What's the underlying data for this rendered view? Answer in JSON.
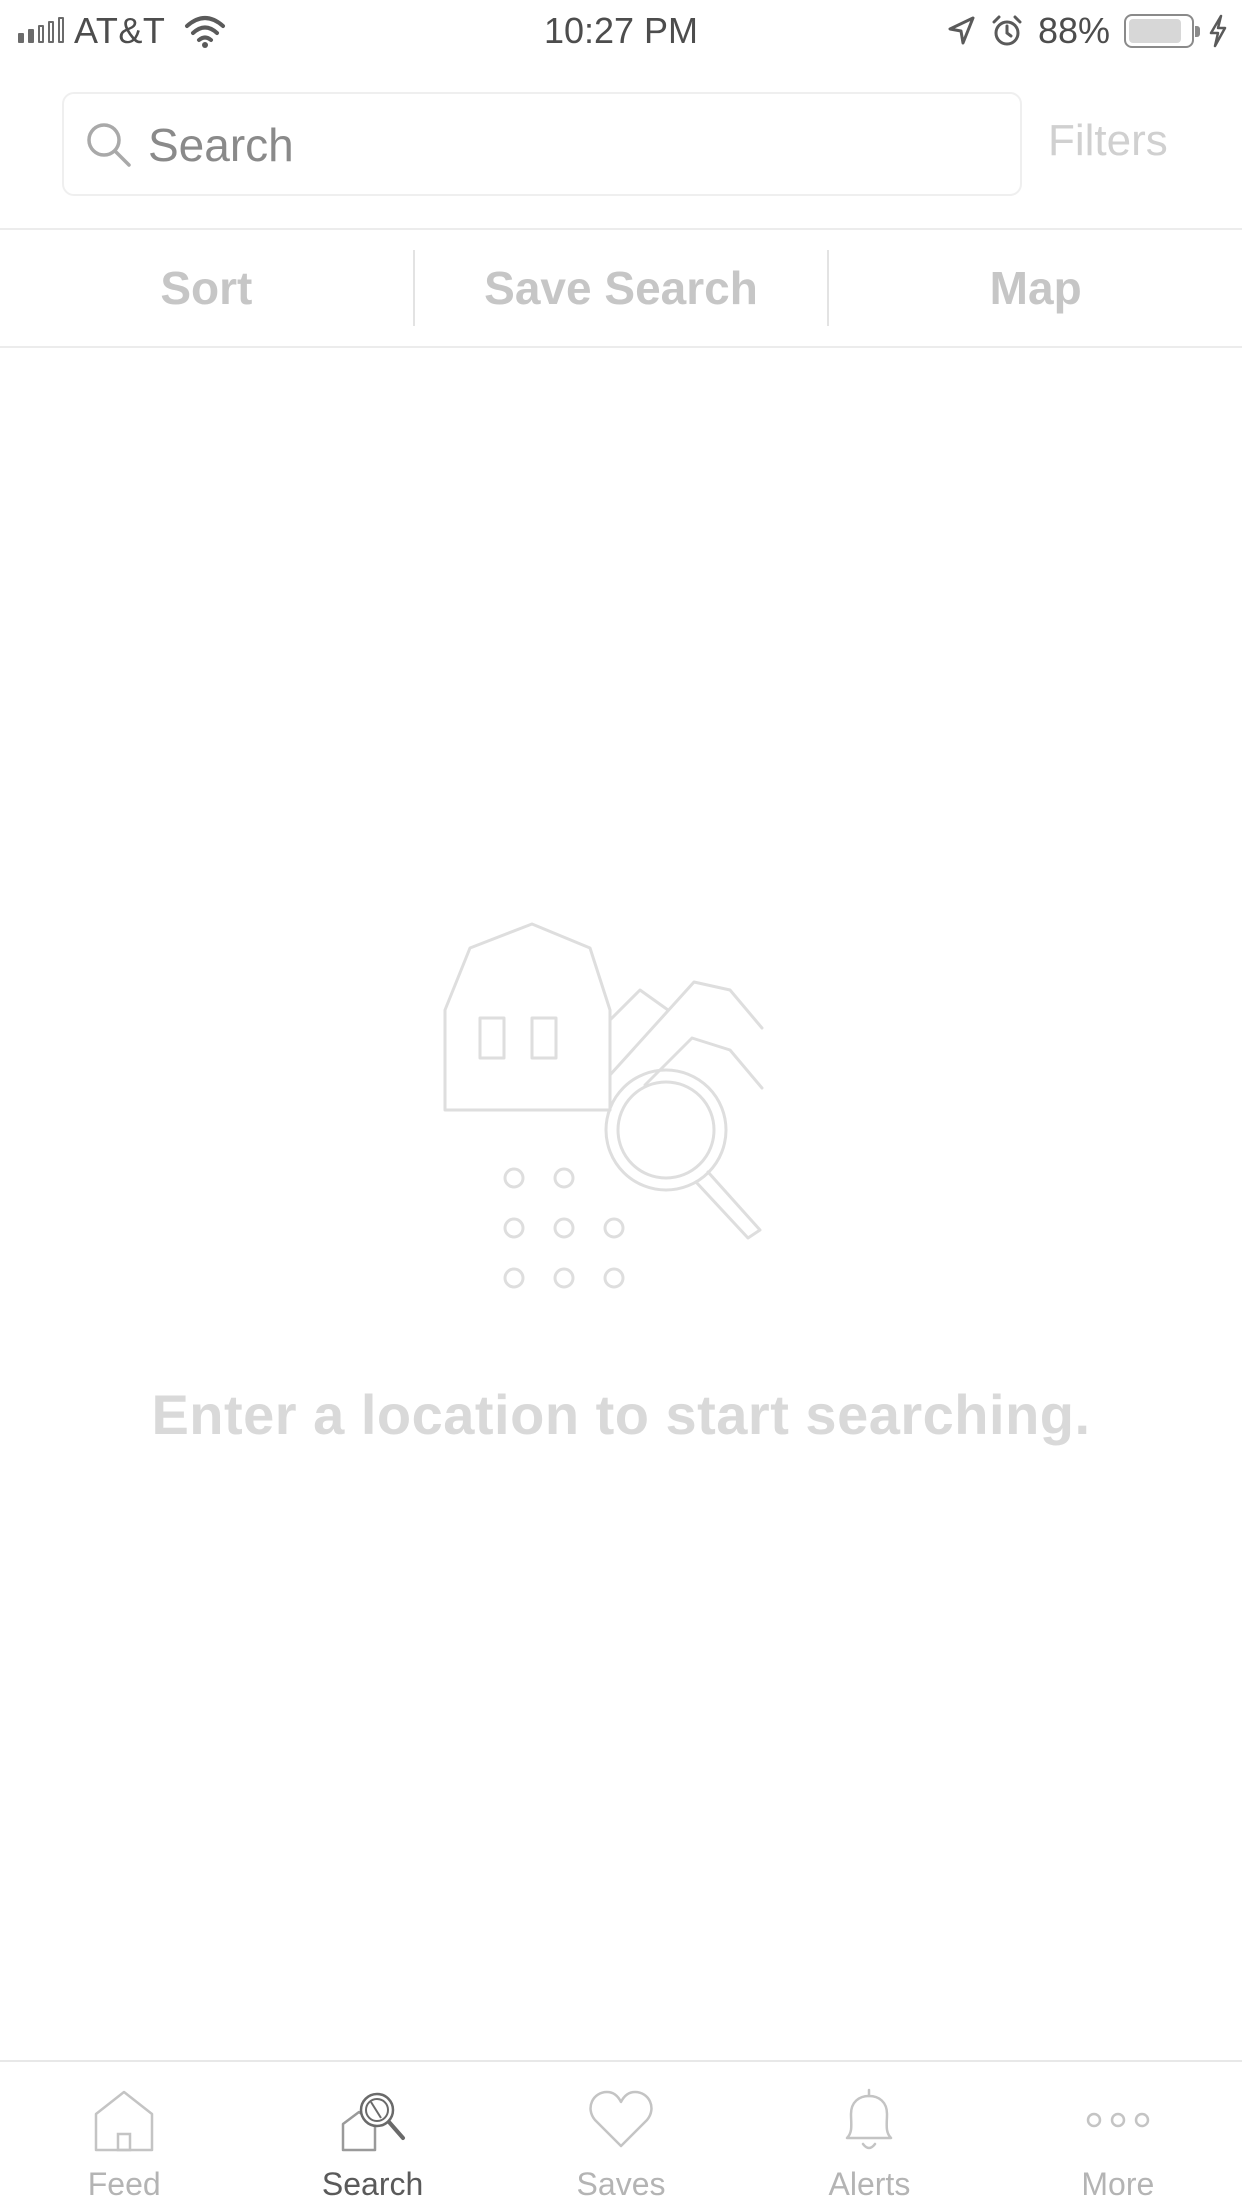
{
  "status_bar": {
    "carrier": "AT&T",
    "time": "10:27 PM",
    "battery_percent": "88%",
    "battery_level": 0.88,
    "signal_bars_filled": 2,
    "signal_bars_total": 5
  },
  "search": {
    "placeholder": "Search",
    "value": "",
    "filters_label": "Filters"
  },
  "toolbar": {
    "sort_label": "Sort",
    "save_search_label": "Save Search",
    "map_label": "Map"
  },
  "empty_state": {
    "message": "Enter a location to start searching."
  },
  "tabs": [
    {
      "label": "Feed",
      "icon": "house-icon",
      "active": false
    },
    {
      "label": "Search",
      "icon": "house-search-icon",
      "active": true
    },
    {
      "label": "Saves",
      "icon": "heart-icon",
      "active": false
    },
    {
      "label": "Alerts",
      "icon": "bell-icon",
      "active": false
    },
    {
      "label": "More",
      "icon": "ellipsis-icon",
      "active": false
    }
  ],
  "colors": {
    "text_dark": "#4d4d4d",
    "muted": "#c6c6c6",
    "active_tab": "#5a5a5a"
  }
}
